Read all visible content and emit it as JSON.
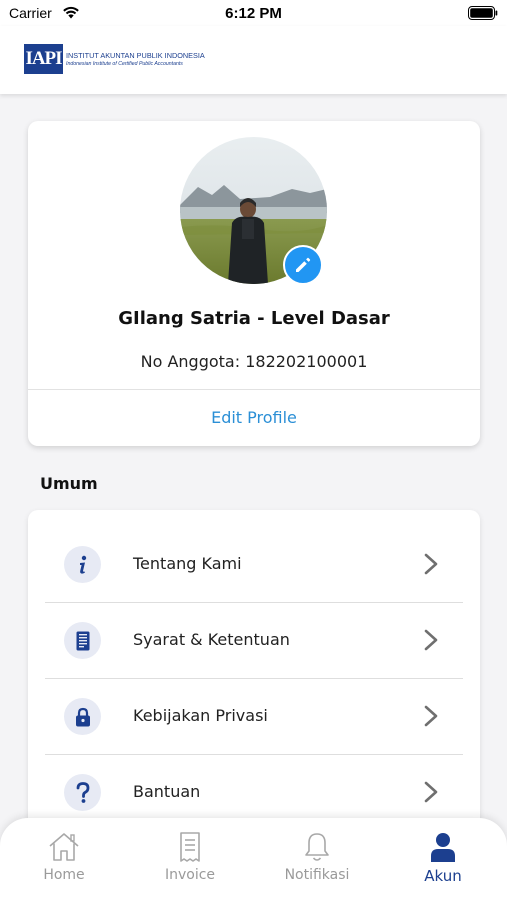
{
  "status_bar": {
    "carrier": "Carrier",
    "time": "6:12 PM"
  },
  "header": {
    "logo_mark": "IAPI",
    "logo_line1": "INSTITUT AKUNTAN PUBLIK INDONESIA",
    "logo_line2": "Indonesian Institute of Certified Public Accountants"
  },
  "profile": {
    "name": "GIlang Satria - Level Dasar",
    "member_no": "No Anggota: 182202100001",
    "edit_label": "Edit Profile"
  },
  "section": {
    "title": "Umum"
  },
  "menu": {
    "items": [
      {
        "label": "Tentang Kami",
        "icon": "info-icon"
      },
      {
        "label": "Syarat & Ketentuan",
        "icon": "document-icon"
      },
      {
        "label": "Kebijakan Privasi",
        "icon": "lock-icon"
      },
      {
        "label": "Bantuan",
        "icon": "help-icon"
      }
    ]
  },
  "tabs": [
    {
      "label": "Home",
      "icon": "home-icon",
      "active": false
    },
    {
      "label": "Invoice",
      "icon": "invoice-icon",
      "active": false
    },
    {
      "label": "Notifikasi",
      "icon": "bell-icon",
      "active": false
    },
    {
      "label": "Akun",
      "icon": "user-icon",
      "active": true
    }
  ],
  "colors": {
    "brand": "#1c3f8f",
    "accent": "#2196f3",
    "link": "#2b8fd6",
    "inactive": "#9a9a9a"
  }
}
